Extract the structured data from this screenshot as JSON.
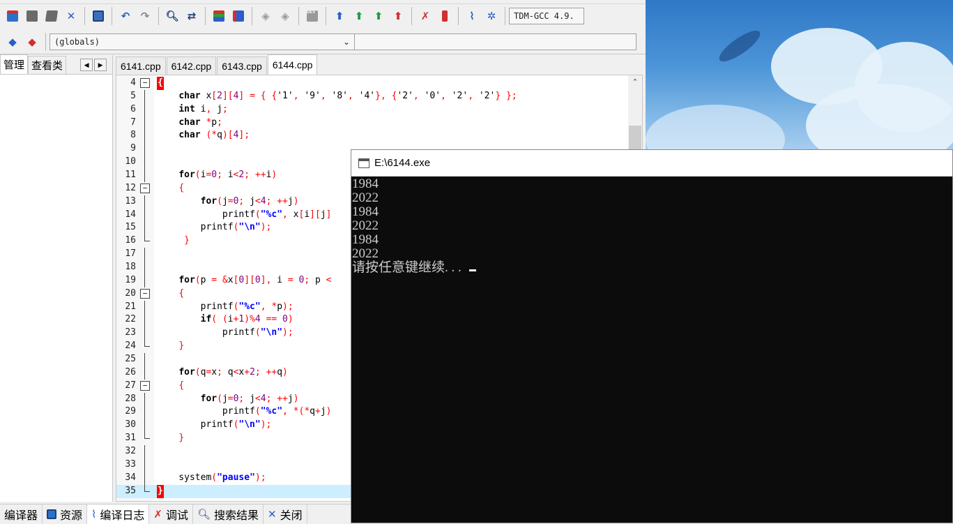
{
  "ide": {
    "toolbar": {
      "compiler_combo": "TDM-GCC 4.9.",
      "globals_combo": "(globals)"
    },
    "left_pane": {
      "tabs": [
        "管理",
        "查看类"
      ]
    },
    "file_tabs": [
      "6141.cpp",
      "6142.cpp",
      "6143.cpp",
      "6144.cpp"
    ],
    "active_file": "6144.cpp",
    "bottom_tabs": [
      {
        "label": "编译器",
        "icon": "compiler-icon"
      },
      {
        "label": "资源",
        "icon": "resources-icon"
      },
      {
        "label": "编译日志",
        "icon": "compile-log-icon"
      },
      {
        "label": "调试",
        "icon": "debug-icon"
      },
      {
        "label": "搜索结果",
        "icon": "search-results-icon"
      },
      {
        "label": "关闭",
        "icon": "close-icon"
      }
    ]
  },
  "code": {
    "line_numbers": [
      "4",
      "5",
      "6",
      "7",
      "8",
      "9",
      "10",
      "11",
      "12",
      "13",
      "14",
      "15",
      "16",
      "17",
      "18",
      "19",
      "20",
      "21",
      "22",
      "23",
      "24",
      "25",
      "26",
      "27",
      "28",
      "29",
      "30",
      "31",
      "32",
      "33",
      "34",
      "35"
    ],
    "lines": [
      "{",
      "    char x[2][4] = { {'1', '9', '8', '4'}, {'2', '0', '2', '2'} };",
      "    int i, j;",
      "    char *p;",
      "    char (*q)[4];",
      "",
      "",
      "    for(i=0; i<2; ++i)",
      "    {",
      "        for(j=0; j<4; ++j)",
      "            printf(\"%c\", x[i][j]",
      "        printf(\"\\n\");",
      "     }",
      "",
      "",
      "    for(p = &x[0][0], i = 0; p <",
      "    {",
      "        printf(\"%c\", *p);",
      "        if( (i+1)%4 == 0)",
      "            printf(\"\\n\");",
      "    }",
      "",
      "    for(q=x; q<x+2; ++q)",
      "    {",
      "        for(j=0; j<4; ++j)",
      "            printf(\"%c\", *(*q+j)",
      "        printf(\"\\n\");",
      "    }",
      "",
      "",
      "    system(\"pause\");",
      "}"
    ]
  },
  "console": {
    "title": "E:\\6144.exe",
    "output": [
      "1984",
      "2022",
      "1984",
      "2022",
      "1984",
      "2022",
      "请按任意键继续. . . "
    ]
  },
  "colors": {
    "keyword": "#000000",
    "symbol": "#ff0000",
    "string": "#0000ff",
    "number": "#800080",
    "highlight_line": "#cceeff",
    "console_bg": "#0c0c0c",
    "console_text": "#cccccc"
  }
}
